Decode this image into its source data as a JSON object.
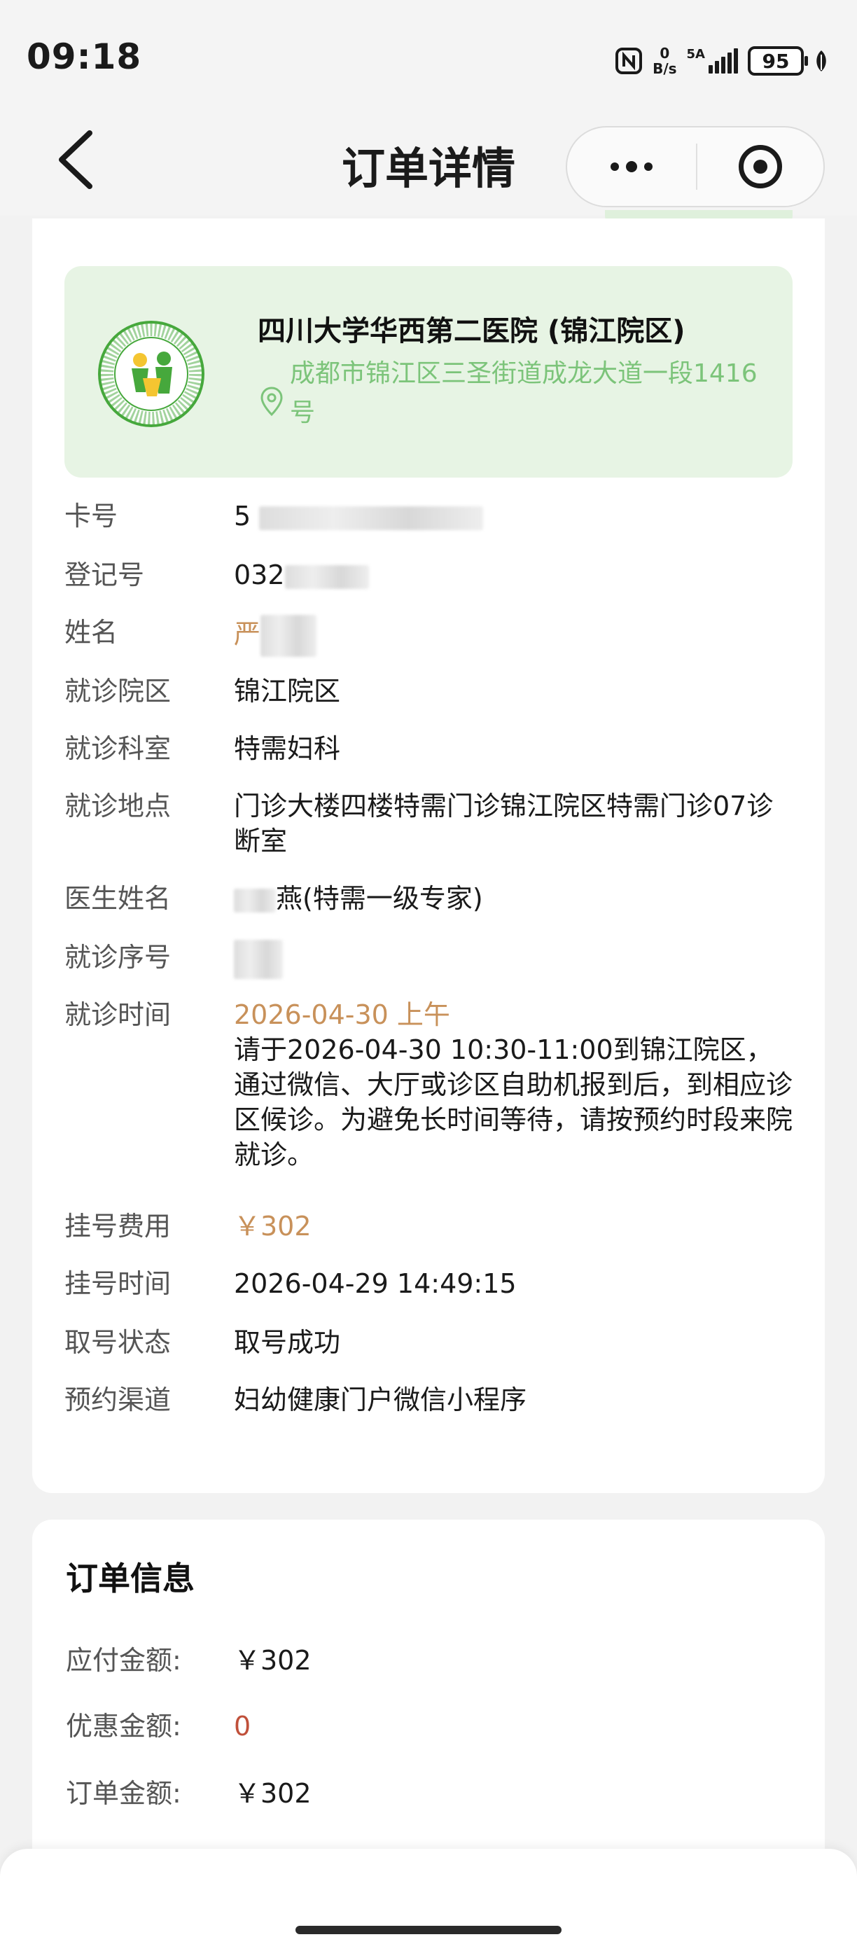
{
  "status_bar": {
    "time": "09:18",
    "net_speed_value": "0",
    "net_speed_unit": "B/s",
    "signal_label": "5A",
    "battery": "95"
  },
  "nav": {
    "title": "订单详情"
  },
  "hospital": {
    "name": "四川大学华西第二医院 (锦江院区)",
    "address": "成都市锦江区三圣街道成龙大道一段1416号"
  },
  "details": [
    {
      "label": "卡号",
      "value": "5",
      "redacted": true
    },
    {
      "label": "登记号",
      "value": "032",
      "redacted": true
    },
    {
      "label": "姓名",
      "value": "严",
      "redacted": true,
      "accent": true
    },
    {
      "label": "就诊院区",
      "value": "锦江院区",
      "redacted": true
    },
    {
      "label": "就诊科室",
      "value": "特需妇科"
    },
    {
      "label": "就诊地点",
      "value": "门诊大楼四楼特需门诊锦江院区特需门诊07诊断室"
    },
    {
      "label": "医生姓名",
      "value": "燕(特需一级专家)",
      "redacted": true
    },
    {
      "label": "就诊序号",
      "value": "",
      "redacted": true
    },
    {
      "label": "就诊时间",
      "value": "2026-04-30 上午",
      "accent": true,
      "sub": "请于2026-04-30 10:30-11:00到锦江院区，通过微信、大厅或诊区自助机报到后，到相应诊区候诊。为避免长时间等待，请按预约时段来院就诊。"
    },
    {
      "label": "挂号费用",
      "value": "￥302",
      "accent": true
    },
    {
      "label": "挂号时间",
      "value": "2026-04-29 14:49:15"
    },
    {
      "label": "取号状态",
      "value": "取号成功"
    },
    {
      "label": "预约渠道",
      "value": "妇幼健康门户微信小程序"
    }
  ],
  "order": {
    "title": "订单信息",
    "rows": [
      {
        "label": "应付金额:",
        "value": "￥302"
      },
      {
        "label": "优惠金额:",
        "value": "0",
        "red": true
      },
      {
        "label": "订单金额:",
        "value": "￥302"
      }
    ]
  },
  "colors": {
    "accent_orange": "#c8915a",
    "green_address": "#7cc47a",
    "hospital_bg": "#e7f4e4",
    "discount_red": "#c0503a"
  }
}
